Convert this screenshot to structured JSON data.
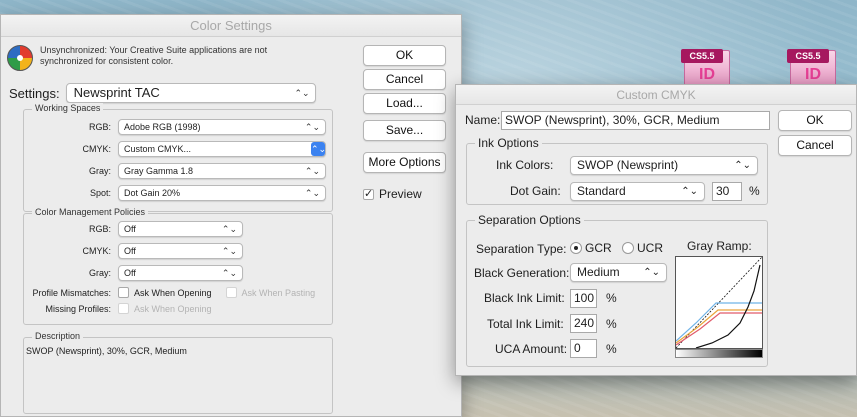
{
  "color_settings": {
    "title": "Color Settings",
    "sync_message": "Unsynchronized: Your Creative Suite applications are not synchronized for consistent color.",
    "settings_label": "Settings:",
    "settings_value": "Newsprint TAC",
    "working_spaces": {
      "title": "Working Spaces",
      "rgb_label": "RGB:",
      "rgb_value": "Adobe RGB (1998)",
      "cmyk_label": "CMYK:",
      "cmyk_value": "Custom CMYK...",
      "gray_label": "Gray:",
      "gray_value": "Gray Gamma 1.8",
      "spot_label": "Spot:",
      "spot_value": "Dot Gain 20%"
    },
    "policies": {
      "title": "Color Management Policies",
      "rgb_label": "RGB:",
      "rgb_value": "Off",
      "cmyk_label": "CMYK:",
      "cmyk_value": "Off",
      "gray_label": "Gray:",
      "gray_value": "Off",
      "mismatch_label": "Profile Mismatches:",
      "ask_opening": "Ask When Opening",
      "ask_pasting": "Ask When Pasting",
      "missing_label": "Missing Profiles:",
      "missing_ask_opening": "Ask When Opening"
    },
    "description": {
      "title": "Description",
      "text": "SWOP (Newsprint), 30%, GCR, Medium"
    },
    "buttons": {
      "ok": "OK",
      "cancel": "Cancel",
      "load": "Load...",
      "save": "Save...",
      "more_options": "More Options"
    },
    "preview_label": "Preview"
  },
  "custom_cmyk": {
    "title": "Custom CMYK",
    "name_label": "Name:",
    "name_value": "SWOP (Newsprint), 30%, GCR, Medium",
    "ok": "OK",
    "cancel": "Cancel",
    "ink_options": {
      "title": "Ink Options",
      "ink_colors_label": "Ink Colors:",
      "ink_colors_value": "SWOP (Newsprint)",
      "dot_gain_label": "Dot Gain:",
      "dot_gain_value": "Standard",
      "dot_gain_percent": "30",
      "percent": "%"
    },
    "separation": {
      "title": "Separation Options",
      "type_label": "Separation Type:",
      "gcr": "GCR",
      "ucr": "UCR",
      "gray_ramp_label": "Gray Ramp:",
      "black_gen_label": "Black Generation:",
      "black_gen_value": "Medium",
      "black_ink_label": "Black Ink Limit:",
      "black_ink_value": "100",
      "total_ink_label": "Total Ink Limit:",
      "total_ink_value": "240",
      "uca_label": "UCA Amount:",
      "uca_value": "0",
      "percent": "%"
    }
  },
  "desktop_icons": [
    {
      "tag": "CS5.5",
      "letter": "ID"
    },
    {
      "tag": "CS5.5",
      "letter": "ID"
    }
  ],
  "colors": {
    "cyan_curve": "#6fb3e8",
    "magenta_curve": "#e15b6b",
    "yellow_curve": "#e9a53a",
    "black_curve": "#111111"
  }
}
